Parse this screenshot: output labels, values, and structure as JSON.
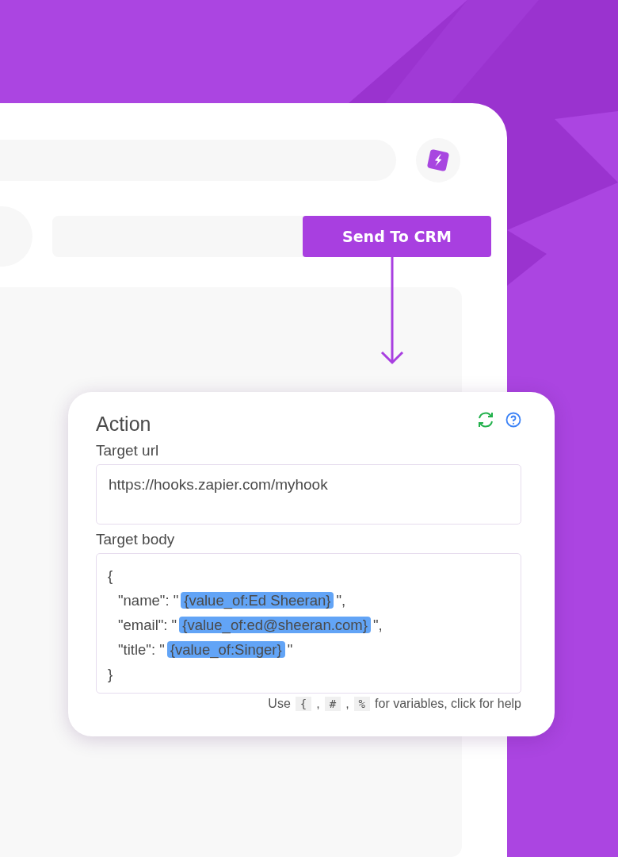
{
  "toolbar": {
    "send_button": "Send To CRM"
  },
  "action_card": {
    "title": "Action",
    "url_label": "Target url",
    "url_value": "https://hooks.zapier.com/myhook",
    "body_label": "Target body",
    "body": {
      "open": "{",
      "close": "}",
      "entries": [
        [
          {
            "kind": "text",
            "text": "\"name\": \""
          },
          {
            "kind": "token",
            "text": "{value_of:Ed Sheeran}"
          },
          {
            "kind": "text",
            "text": "\","
          }
        ],
        [
          {
            "kind": "text",
            "text": "\"email\": \""
          },
          {
            "kind": "token",
            "text": "{value_of:ed@sheeran.com}"
          },
          {
            "kind": "text",
            "text": "\","
          }
        ],
        [
          {
            "kind": "text",
            "text": "\"title\": \""
          },
          {
            "kind": "token",
            "text": "{value_of:Singer}"
          },
          {
            "kind": "text",
            "text": "\""
          }
        ]
      ]
    },
    "hint": [
      {
        "kind": "text",
        "text": "Use"
      },
      {
        "kind": "key",
        "text": "{"
      },
      {
        "kind": "text",
        "text": ","
      },
      {
        "kind": "key",
        "text": "#"
      },
      {
        "kind": "text",
        "text": ","
      },
      {
        "kind": "key",
        "text": "%"
      },
      {
        "kind": "text",
        "text": "for variables, click for help"
      }
    ]
  }
}
